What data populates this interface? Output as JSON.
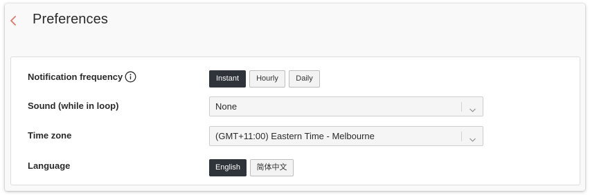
{
  "header": {
    "back_icon": "chevron-left-icon",
    "back_color": "#e07868",
    "title": "Preferences"
  },
  "notification": {
    "label": "Notification frequency",
    "info_icon": "info-circle-icon",
    "options": [
      "Instant",
      "Hourly",
      "Daily"
    ],
    "selected": "Instant"
  },
  "sound": {
    "label": "Sound (while in loop)",
    "value": "None",
    "icon": "chevron-down-icon"
  },
  "timezone": {
    "label": "Time zone",
    "value": "(GMT+11:00) Eastern Time - Melbourne",
    "icon": "chevron-down-icon"
  },
  "language": {
    "label": "Language",
    "options": [
      "English",
      "简体中文"
    ],
    "selected": "English"
  },
  "colors": {
    "active_segment": "#2f333a",
    "panel_background": "#f9f9f9"
  }
}
